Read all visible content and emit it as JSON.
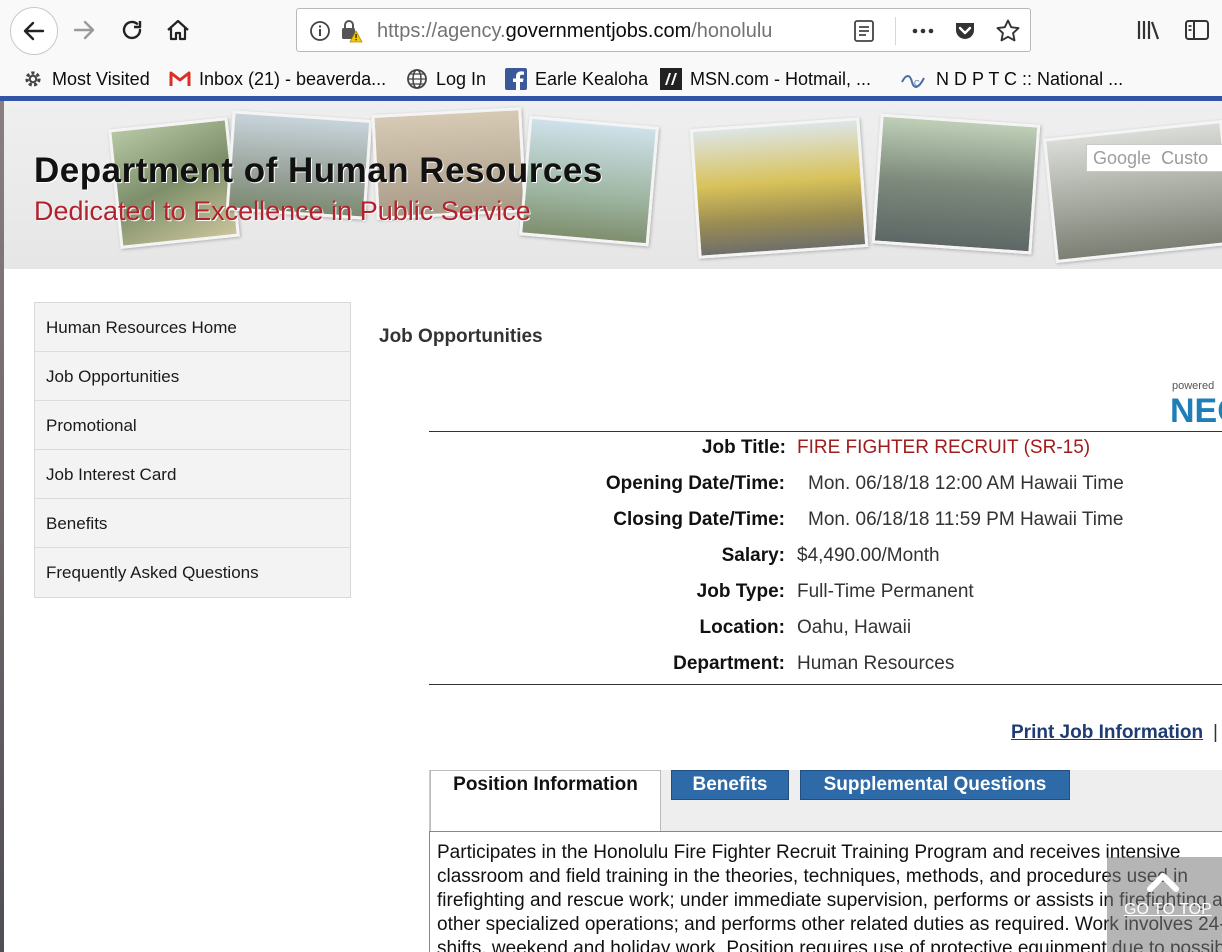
{
  "browser": {
    "url_prefix": "https://agency.",
    "url_domain": "governmentjobs.com",
    "url_rest": "/honolulu",
    "bookmarks": [
      {
        "label": "Most Visited",
        "icon": "gear-icon"
      },
      {
        "label": "Inbox (21) - beaverda...",
        "icon": "gmail-icon"
      },
      {
        "label": "Log In",
        "icon": "globe-icon"
      },
      {
        "label": "Earle Kealoha",
        "icon": "facebook-icon"
      },
      {
        "label": "MSN.com - Hotmail, ...",
        "icon": "msn-icon"
      },
      {
        "label": "N D P T C :: National ...",
        "icon": "ndptc-icon"
      }
    ]
  },
  "banner": {
    "title": "Department of Human Resources",
    "subtitle": "Dedicated to Excellence in Public Service",
    "search_brand": "Google",
    "search_placeholder": "Custo"
  },
  "sidebar": {
    "items": [
      {
        "label": "Human Resources Home"
      },
      {
        "label": "Job Opportunities"
      },
      {
        "label": "Promotional"
      },
      {
        "label": "Job Interest Card"
      },
      {
        "label": "Benefits"
      },
      {
        "label": "Frequently Asked Questions"
      }
    ]
  },
  "main": {
    "section_title": "Job Opportunities",
    "powered_by": "powered",
    "powered_brand": "NEO",
    "job": [
      {
        "label": "Job Title:",
        "value": "FIRE FIGHTER RECRUIT (SR-15)"
      },
      {
        "label": "Opening Date/Time:",
        "value": "Mon. 06/18/18 12:00 AM Hawaii Time"
      },
      {
        "label": "Closing Date/Time:",
        "value": "Mon. 06/18/18 11:59 PM Hawaii Time"
      },
      {
        "label": "Salary:",
        "value": "$4,490.00/Month"
      },
      {
        "label": "Job Type:",
        "value": "Full-Time Permanent"
      },
      {
        "label": "Location:",
        "value": "Oahu, Hawaii"
      },
      {
        "label": "Department:",
        "value": "Human Resources"
      }
    ],
    "print_link": "Print Job Information",
    "pipe": "|",
    "tabs": [
      {
        "label": "Position Information"
      },
      {
        "label": "Benefits"
      },
      {
        "label": "Supplemental Questions"
      }
    ],
    "description": "Participates in the Honolulu Fire Fighter Recruit Training Program and receives intensive classroom and field training in the theories, techniques, methods, and procedures used in firefighting and rescue work; under immediate supervision, performs or assists in firefighting and other specialized operations; and performs other related duties as required. Work involves 24-hour shifts, weekend and holiday work. Position requires use of protective equipment due to possible exposure to hazards.",
    "go_to_top": "GO TO TOP"
  },
  "colors": {
    "accent_blue": "#2f6aa8",
    "job_title_red": "#a01d1d",
    "banner_red": "#b2222c",
    "progress_blue": "#3355a8"
  }
}
